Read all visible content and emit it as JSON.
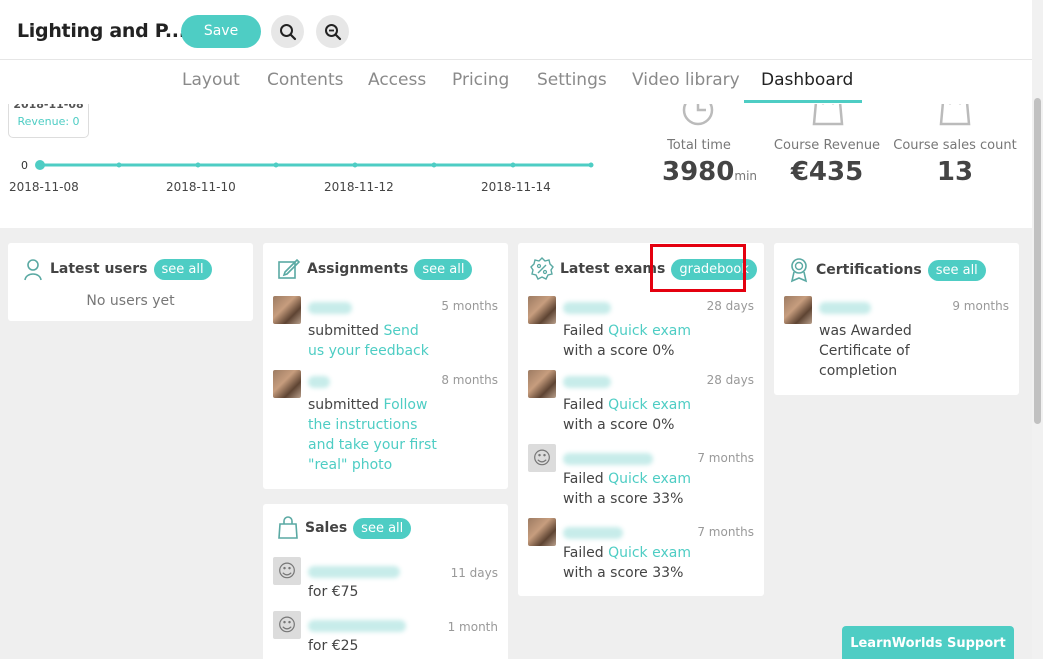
{
  "header": {
    "course_title": "Lighting and P...",
    "save_label": "Save"
  },
  "tabs": [
    "Layout",
    "Contents",
    "Access",
    "Pricing",
    "Settings",
    "Video library",
    "Dashboard"
  ],
  "active_tab": "Dashboard",
  "timeline": {
    "tooltip_date": "2018-11-08",
    "tooltip_revenue": "Revenue: 0",
    "y_zero": "0",
    "x_labels": [
      "2018-11-08",
      "2018-11-10",
      "2018-11-12",
      "2018-11-14"
    ]
  },
  "stats": {
    "total_time": {
      "label": "Total time",
      "value": "3980",
      "unit": "min"
    },
    "course_revenue": {
      "label": "Course Revenue",
      "value": "€435"
    },
    "sales_count": {
      "label": "Course sales count",
      "value": "13"
    }
  },
  "cards": {
    "latest_users": {
      "title": "Latest users",
      "pill": "see all",
      "empty": "No users yet"
    },
    "assignments": {
      "title": "Assignments",
      "pill": "see all",
      "items": [
        {
          "time": "5 months",
          "prefix": "submitted ",
          "link": "Send us your feedback"
        },
        {
          "time": "8 months",
          "prefix": "submitted ",
          "link": "Follow the instructions and take your first \"real\" photo"
        }
      ]
    },
    "latest_exams": {
      "title": "Latest exams",
      "pill": "gradebook",
      "items": [
        {
          "time": "28 days",
          "prefix": "Failed ",
          "link": "Quick exam",
          "suffix": " with a score 0%"
        },
        {
          "time": "28 days",
          "prefix": "Failed ",
          "link": "Quick exam",
          "suffix": " with a score 0%"
        },
        {
          "time": "7 months",
          "prefix": "Failed ",
          "link": "Quick exam",
          "suffix": " with a score 33%"
        },
        {
          "time": "7 months",
          "prefix": "Failed ",
          "link": "Quick exam",
          "suffix": " with a score 33%"
        }
      ]
    },
    "certifications": {
      "title": "Certifications",
      "pill": "see all",
      "items": [
        {
          "time": "9 months",
          "text": "was Awarded Certificate of completion"
        }
      ]
    },
    "sales": {
      "title": "Sales",
      "pill": "see all",
      "items": [
        {
          "time": "11 days",
          "text": "for €75"
        },
        {
          "time": "1 month",
          "text": "for €25"
        }
      ]
    }
  },
  "support_label": "LearnWorlds Support",
  "accent_color": "#4ecdc4"
}
